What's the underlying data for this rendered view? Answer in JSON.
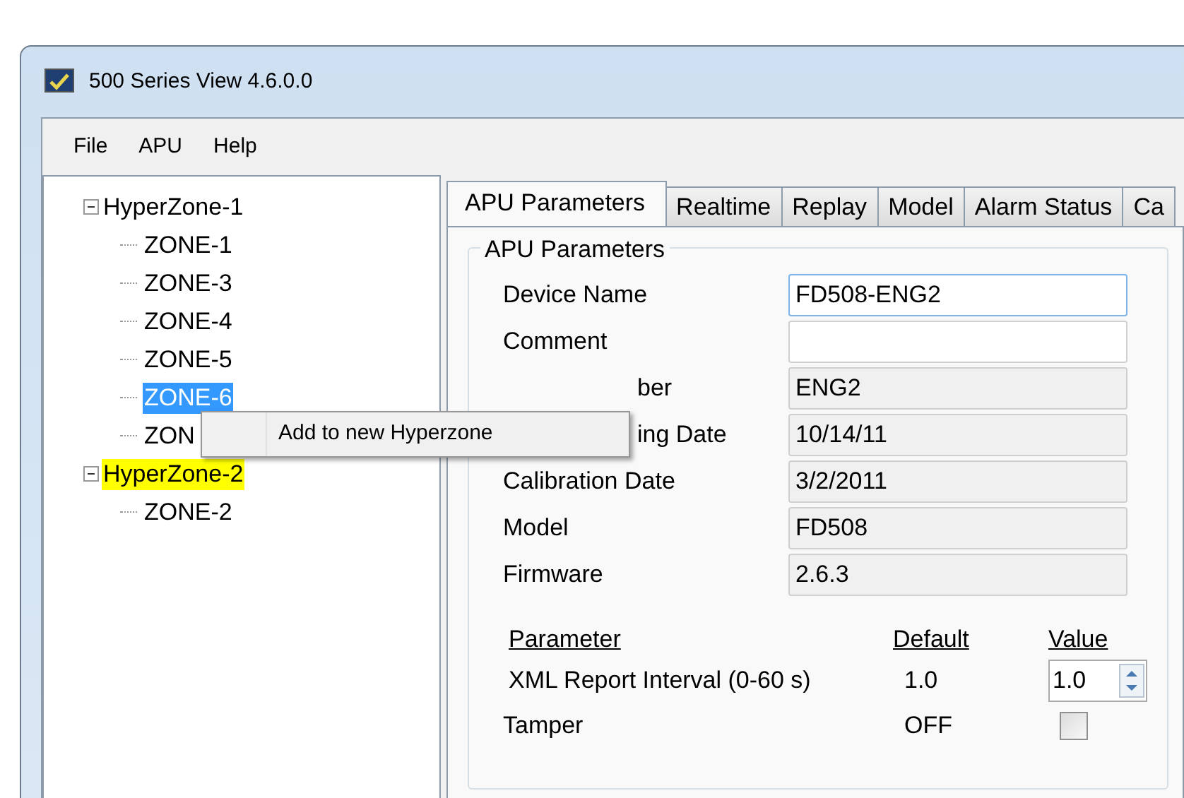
{
  "window": {
    "title": "500 Series View 4.6.0.0"
  },
  "menu": [
    "File",
    "APU",
    "Help"
  ],
  "tree": [
    {
      "label": "HyperZone-1",
      "expanded": true,
      "selected": false,
      "highlighted": false,
      "children": [
        {
          "label": "ZONE-1",
          "selected": false,
          "highlighted": false
        },
        {
          "label": "ZONE-3",
          "selected": false,
          "highlighted": false
        },
        {
          "label": "ZONE-4",
          "selected": false,
          "highlighted": false
        },
        {
          "label": "ZONE-5",
          "selected": false,
          "highlighted": false
        },
        {
          "label": "ZONE-6",
          "selected": true,
          "highlighted": false
        },
        {
          "label": "ZON",
          "selected": false,
          "highlighted": false
        }
      ]
    },
    {
      "label": "HyperZone-2",
      "expanded": true,
      "selected": false,
      "highlighted": true,
      "children": [
        {
          "label": "ZONE-2",
          "selected": false,
          "highlighted": false
        }
      ]
    }
  ],
  "context_menu": {
    "items": [
      "Add to new Hyperzone"
    ]
  },
  "tabs": [
    {
      "label": "APU Parameters",
      "selected": true
    },
    {
      "label": "Realtime",
      "selected": false
    },
    {
      "label": "Replay",
      "selected": false
    },
    {
      "label": "Model",
      "selected": false
    },
    {
      "label": "Alarm Status",
      "selected": false
    },
    {
      "label": "Ca",
      "selected": false
    }
  ],
  "group": {
    "title": "APU Parameters"
  },
  "fields": [
    {
      "label": "Device Name",
      "value": "FD508-ENG2",
      "editable": true,
      "focused": true,
      "covered": false
    },
    {
      "label": "Comment",
      "editable": true,
      "focused": false,
      "covered": false
    },
    {
      "label": "ber",
      "value": "ENG2",
      "editable": false,
      "focused": false,
      "covered": true
    },
    {
      "label": "ing Date",
      "value": "10/14/11",
      "editable": false,
      "focused": false,
      "covered": true
    },
    {
      "label": "Calibration Date",
      "value": "3/2/2011",
      "editable": false,
      "focused": false,
      "covered": false
    },
    {
      "label": "Model",
      "value": "FD508",
      "editable": false,
      "focused": false,
      "covered": false
    },
    {
      "label": "Firmware",
      "value": "2.6.3",
      "editable": false,
      "focused": false,
      "covered": false
    }
  ],
  "parameters": {
    "columns": [
      "Parameter",
      "Default",
      "Value"
    ],
    "rows": [
      {
        "kind": "spinner",
        "name": "XML Report Interval (0-60 s)",
        "default": "1.0",
        "value": "1.0"
      },
      {
        "kind": "checkbox",
        "name": "Tamper",
        "default": "OFF",
        "checked": false
      }
    ]
  }
}
